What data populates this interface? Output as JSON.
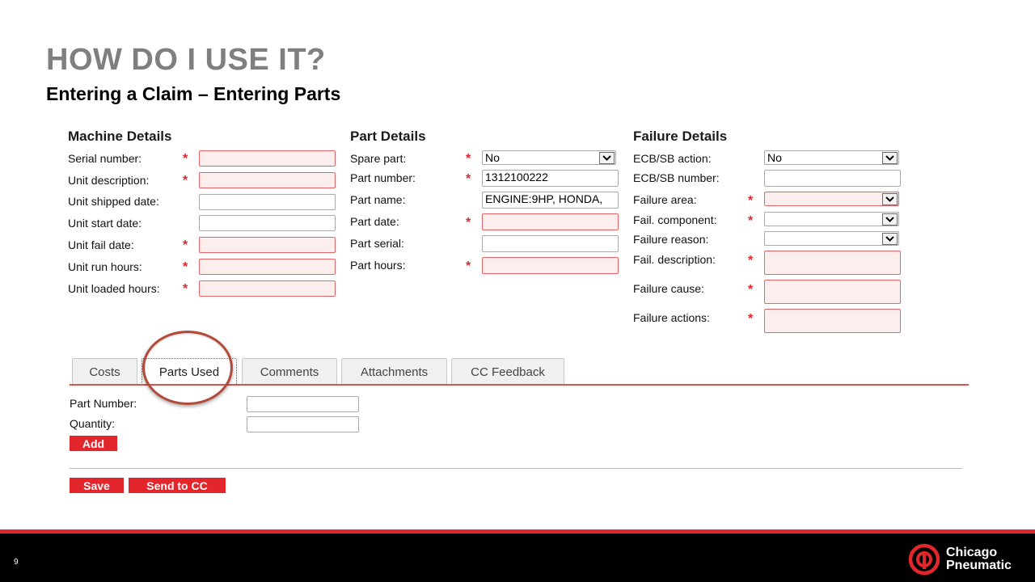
{
  "header": {
    "title": "HOW DO I USE IT?",
    "subtitle": "Entering a Claim – Entering Parts"
  },
  "machine": {
    "heading": "Machine Details",
    "fields": [
      {
        "label": "Serial number:",
        "required": true,
        "value": ""
      },
      {
        "label": "Unit description:",
        "required": true,
        "value": ""
      },
      {
        "label": "Unit shipped date:",
        "required": false,
        "value": ""
      },
      {
        "label": "Unit start date:",
        "required": false,
        "value": ""
      },
      {
        "label": "Unit fail date:",
        "required": true,
        "value": ""
      },
      {
        "label": "Unit run hours:",
        "required": true,
        "value": ""
      },
      {
        "label": "Unit loaded hours:",
        "required": true,
        "value": ""
      }
    ]
  },
  "part": {
    "heading": "Part Details",
    "fields": [
      {
        "label": "Spare part:",
        "required": true,
        "value": "No"
      },
      {
        "label": "Part number:",
        "required": true,
        "value": "1312100222"
      },
      {
        "label": "Part name:",
        "required": false,
        "value": "ENGINE:9HP, HONDA,"
      },
      {
        "label": "Part date:",
        "required": true,
        "value": ""
      },
      {
        "label": "Part serial:",
        "required": false,
        "value": ""
      },
      {
        "label": "Part hours:",
        "required": true,
        "value": ""
      }
    ]
  },
  "failure": {
    "heading": "Failure Details",
    "fields": [
      {
        "label": "ECB/SB action:",
        "required": false,
        "value": "No"
      },
      {
        "label": "ECB/SB number:",
        "required": false,
        "value": ""
      },
      {
        "label": "Failure area:",
        "required": true,
        "value": ""
      },
      {
        "label": "Fail. component:",
        "required": true,
        "value": ""
      },
      {
        "label": "Failure reason:",
        "required": false,
        "value": ""
      },
      {
        "label": "Fail. description:",
        "required": true,
        "value": ""
      },
      {
        "label": "Failure cause:",
        "required": true,
        "value": ""
      },
      {
        "label": "Failure actions:",
        "required": true,
        "value": ""
      }
    ]
  },
  "required_marker": "*",
  "tabs": [
    {
      "label": "Costs"
    },
    {
      "label": "Parts Used",
      "active": true
    },
    {
      "label": "Comments"
    },
    {
      "label": "Attachments"
    },
    {
      "label": "CC Feedback"
    }
  ],
  "parts_used": {
    "part_number_label": "Part Number:",
    "part_number_value": "",
    "quantity_label": "Quantity:",
    "quantity_value": "",
    "add_label": "Add"
  },
  "actions": {
    "save_label": "Save",
    "send_label": "Send to CC"
  },
  "footer": {
    "page_number": "9",
    "logo_line1": "Chicago",
    "logo_line2": "Pneumatic"
  },
  "colors": {
    "accent": "#e3262c",
    "title_gray": "#7f7f7f",
    "required_bg": "#fdeeee",
    "required_border": "#e8636a",
    "highlight_circle": "#b24a3a",
    "footer_bg": "#000000"
  }
}
